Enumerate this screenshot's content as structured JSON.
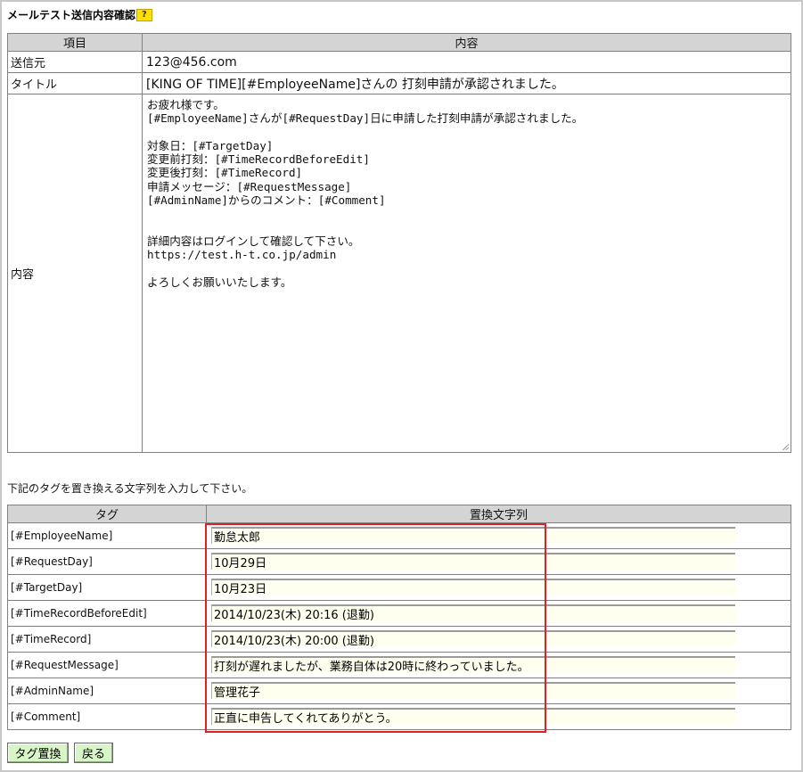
{
  "page": {
    "title": "メールテスト送信内容確認",
    "help_label": "?"
  },
  "preview": {
    "headers": [
      "項目",
      "内容"
    ],
    "sender_label": "送信元",
    "sender_value": "123@456.com",
    "subject_label": "タイトル",
    "subject_value": "[KING OF TIME][#EmployeeName]さんの 打刻申請が承認されました。",
    "body_label": "内容",
    "body_value": "お疲れ様です。\n[#EmployeeName]さんが[#RequestDay]日に申請した打刻申請が承認されました。\n\n対象日：[#TargetDay]\n変更前打刻：[#TimeRecordBeforeEdit]\n変更後打刻：[#TimeRecord]\n申請メッセージ：[#RequestMessage]\n[#AdminName]からのコメント：[#Comment]\n\n\n詳細内容はログインして確認して下さい。\nhttps://test.h-t.co.jp/admin\n\nよろしくお願いいたします。"
  },
  "instruction": "下記のタグを置き換える文字列を入力して下さい。",
  "tags": {
    "headers": [
      "タグ",
      "置換文字列"
    ],
    "rows": [
      {
        "tag": "[#EmployeeName]",
        "value": "勤怠太郎"
      },
      {
        "tag": "[#RequestDay]",
        "value": "10月29日"
      },
      {
        "tag": "[#TargetDay]",
        "value": "10月23日"
      },
      {
        "tag": "[#TimeRecordBeforeEdit]",
        "value": "2014/10/23(木) 20:16 (退勤)"
      },
      {
        "tag": "[#TimeRecord]",
        "value": "2014/10/23(木) 20:00 (退勤)"
      },
      {
        "tag": "[#RequestMessage]",
        "value": "打刻が遅れましたが、業務自体は20時に終わっていました。"
      },
      {
        "tag": "[#AdminName]",
        "value": "管理花子"
      },
      {
        "tag": "[#Comment]",
        "value": "正直に申告してくれてありがとう。"
      }
    ]
  },
  "buttons": {
    "replace_label": "タグ置換",
    "back_label": "戻る"
  },
  "colors": {
    "header_bg": "#d4d4d4",
    "input_bg": "#fffff0",
    "button_bg": "#d8f5c8",
    "highlight": "#e02020",
    "help_badge": "#ffe000"
  }
}
